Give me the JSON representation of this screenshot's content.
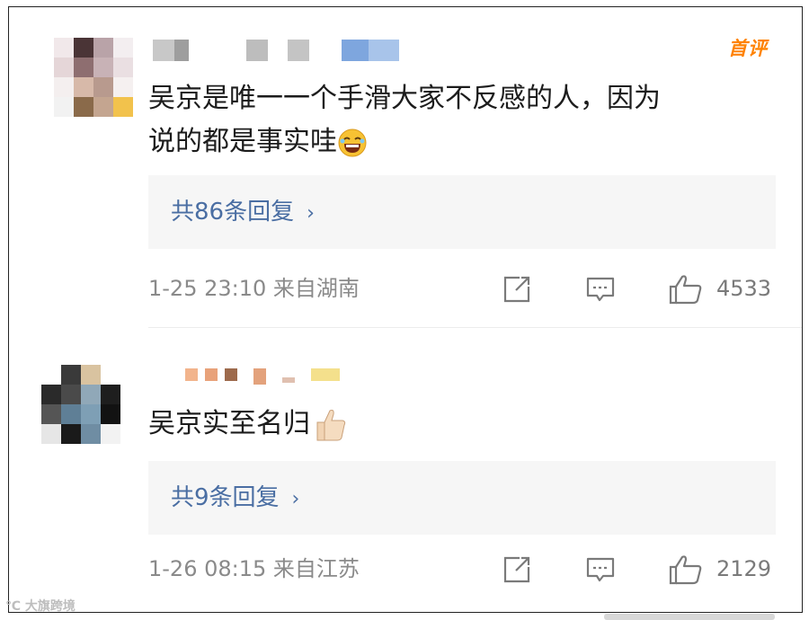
{
  "comments": [
    {
      "badge": "首评",
      "text_line1": "吴京是唯一一个手滑大家不反感的人，因为",
      "text_line2": "说的都是事实哇",
      "emoji": "laughing-emoji",
      "replies_label": "共86条回复",
      "reply_chevron": "›",
      "meta": "1-25 23:10  来自湖南",
      "likes": "4533"
    },
    {
      "text_line1": "吴京实至名归",
      "emoji": "thumbs-up-emoji",
      "replies_label": "共9条回复",
      "reply_chevron": "›",
      "meta": "1-26 08:15  来自江苏",
      "likes": "2129"
    }
  ],
  "watermark": "℃ 大旗跨境",
  "colors": {
    "accent_link": "#4a6ea3",
    "badge": "#ff8200",
    "meta_gray": "#8a8a8a"
  }
}
